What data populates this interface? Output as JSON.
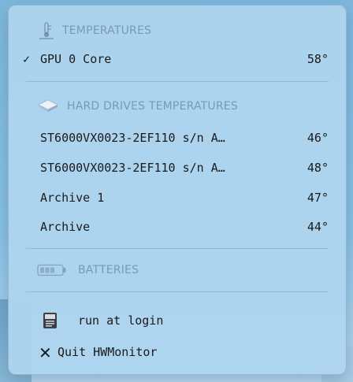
{
  "menu": {
    "temperatures": {
      "header": "TEMPERATURES",
      "icon": "thermometer-icon",
      "items": [
        {
          "label": "GPU 0 Core",
          "value": "58°",
          "checked": true,
          "check_mark": "✓"
        }
      ]
    },
    "hard_drives": {
      "header": "HARD DRIVES TEMPERATURES",
      "icon": "hard-drive-icon",
      "items": [
        {
          "label": "ST6000VX0023-2EF110 s/n A…",
          "value": "46°"
        },
        {
          "label": "ST6000VX0023-2EF110 s/n A…",
          "value": "48°"
        },
        {
          "label": "Archive 1",
          "value": "47°"
        },
        {
          "label": "Archive",
          "value": "44°"
        }
      ]
    },
    "batteries": {
      "header": "BATTERIES",
      "icon": "battery-icon"
    },
    "actions": {
      "run_at_login": {
        "label": "run at login",
        "icon": "login-item-icon"
      },
      "quit": {
        "label": "Quit HWMonitor",
        "icon": "close-icon",
        "glyph": "✕"
      }
    }
  }
}
